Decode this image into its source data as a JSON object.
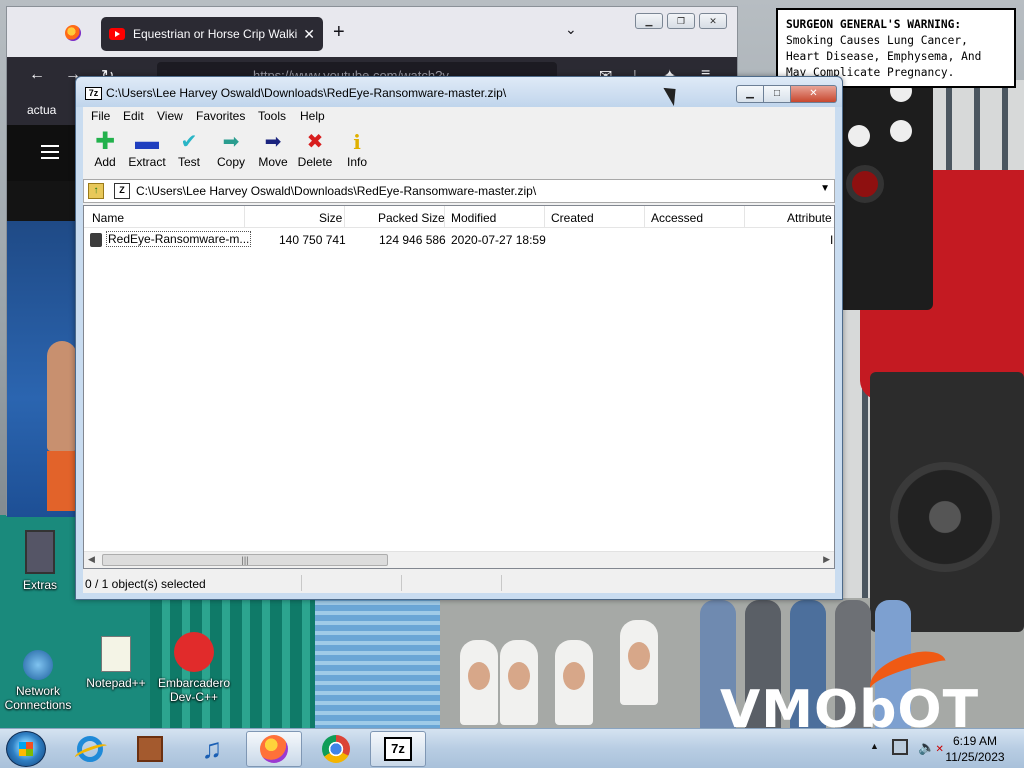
{
  "desktop": {
    "warning": {
      "heading": "SURGEON GENERAL'S WARNING:",
      "body": "Smoking Causes Lung Cancer, Heart Disease, Emphysema, And May Complicate Pregnancy."
    },
    "icons": [
      {
        "label": "Extras",
        "icon": "folder-icon"
      },
      {
        "label": "Network Connections",
        "icon": "network-icon"
      },
      {
        "label": "Notepad++",
        "icon": "notepad-plus-plus-icon"
      },
      {
        "label": "Embarcadero Dev-C++",
        "icon": "dev-cpp-icon"
      }
    ],
    "watermark": "VMObOT"
  },
  "browser": {
    "tab_title": "Equestrian or Horse Crip Walking",
    "url": "https://www.youtube.com/watch?v",
    "bookmark": "actua"
  },
  "sevenzip": {
    "title": "C:\\Users\\Lee Harvey Oswald\\Downloads\\RedEye-Ransomware-master.zip\\",
    "menu": [
      "File",
      "Edit",
      "View",
      "Favorites",
      "Tools",
      "Help"
    ],
    "toolbar": [
      {
        "label": "Add",
        "icon": "plus-icon",
        "color": "#22b14c"
      },
      {
        "label": "Extract",
        "icon": "minus-icon",
        "color": "#1f3fbf"
      },
      {
        "label": "Test",
        "icon": "check-icon",
        "color": "#29b5c6"
      },
      {
        "label": "Copy",
        "icon": "copy-arrow-icon",
        "color": "#2a9d8f"
      },
      {
        "label": "Move",
        "icon": "move-arrow-icon",
        "color": "#1a237e"
      },
      {
        "label": "Delete",
        "icon": "x-icon",
        "color": "#d81e1e"
      },
      {
        "label": "Info",
        "icon": "info-icon",
        "color": "#e0b000"
      }
    ],
    "address": "C:\\Users\\Lee Harvey Oswald\\Downloads\\RedEye-Ransomware-master.zip\\",
    "columns": [
      "Name",
      "Size",
      "Packed Size",
      "Modified",
      "Created",
      "Accessed",
      "Attribute"
    ],
    "rows": [
      {
        "name": "RedEye-Ransomware-m...",
        "size": "140 750 741",
        "packed": "124 946 586",
        "modified": "2020-07-27 18:59",
        "created": "",
        "accessed": "",
        "attributes": "I"
      }
    ],
    "status": "0 / 1 object(s) selected"
  },
  "taskbar": {
    "clock_time": "6:19 AM",
    "clock_date": "11/25/2023"
  }
}
